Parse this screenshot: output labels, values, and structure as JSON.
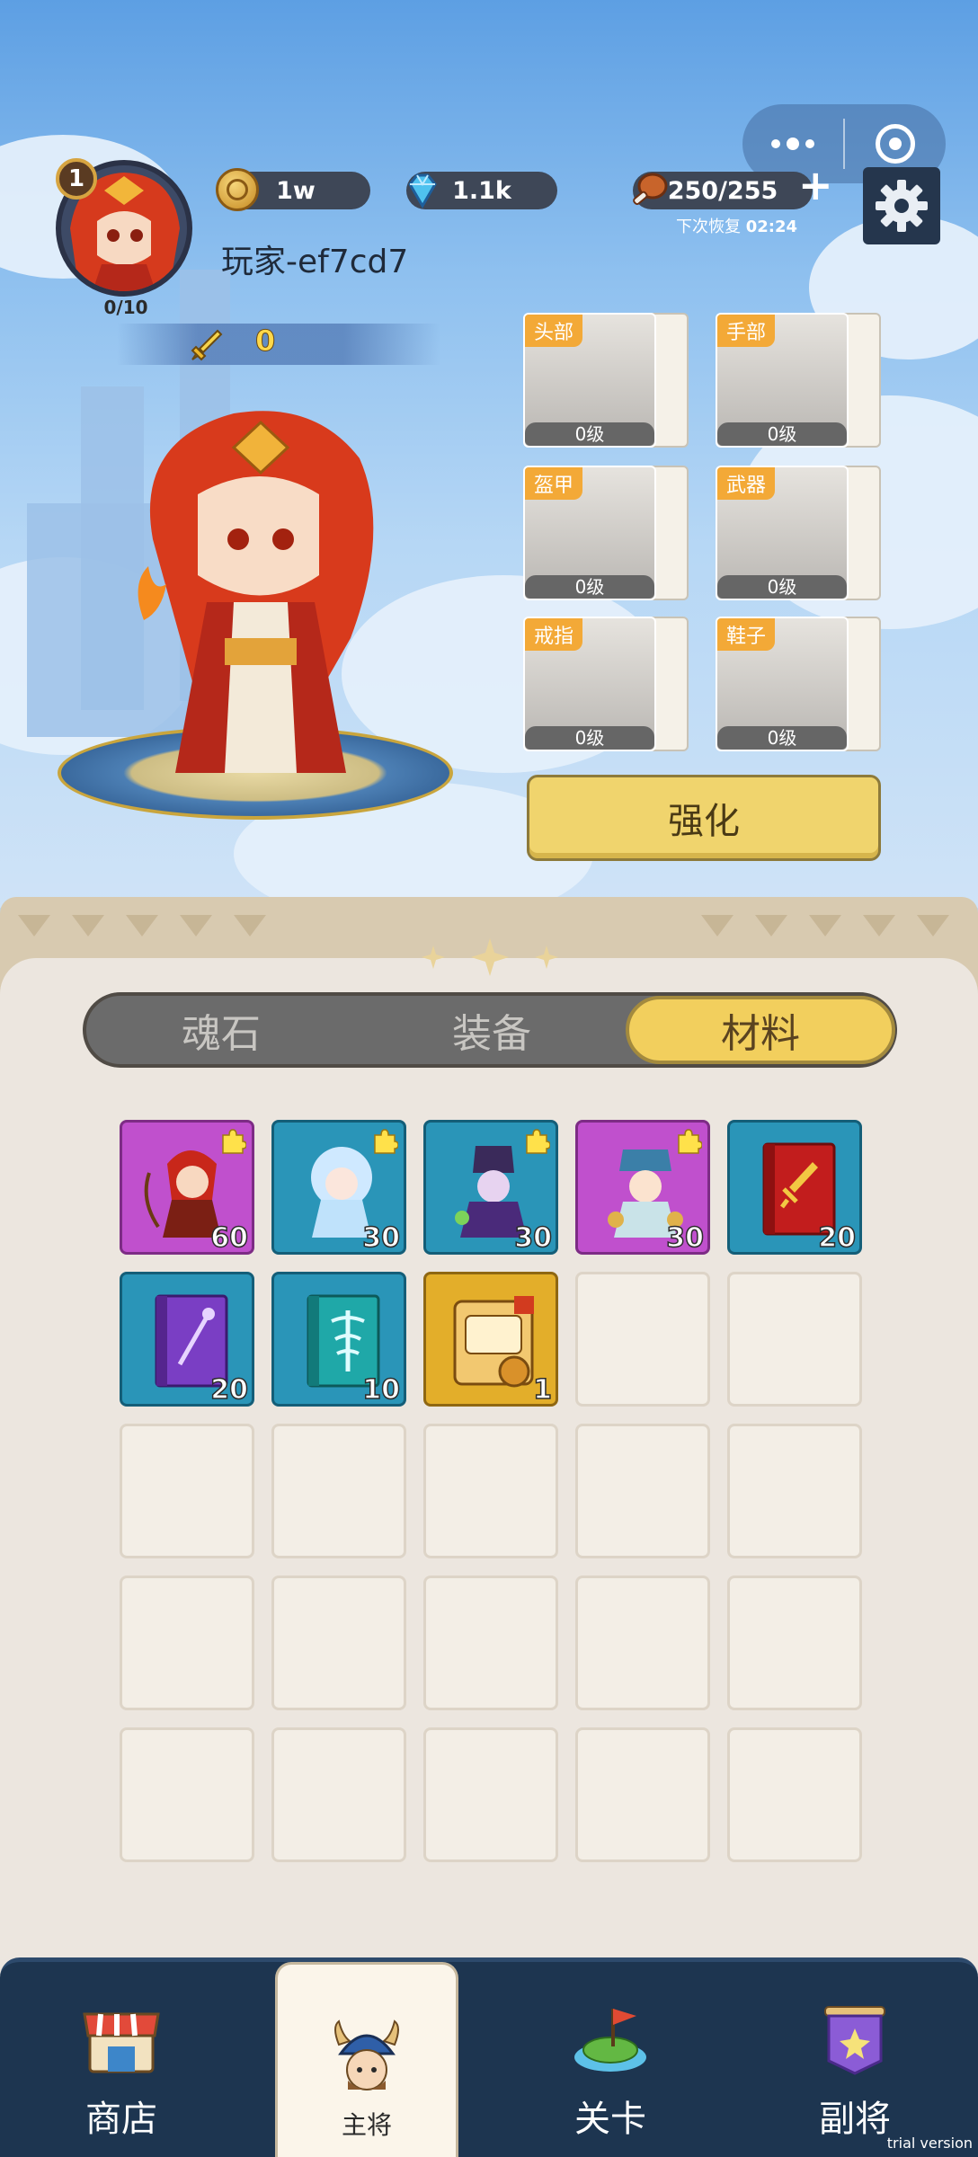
{
  "capsule": {
    "more": "more-icon",
    "close": "target-icon"
  },
  "player": {
    "level": "1",
    "exp": "0/10",
    "name": "玩家-ef7cd7",
    "power": "0"
  },
  "resources": {
    "gold": "1w",
    "diamond": "1.1k",
    "stamina": "250/255",
    "recover_label": "下次恢复",
    "recover_time": "02:24"
  },
  "equipment": [
    {
      "slot": "头部",
      "level": "0级"
    },
    {
      "slot": "手部",
      "level": "0级"
    },
    {
      "slot": "盔甲",
      "level": "0级"
    },
    {
      "slot": "武器",
      "level": "0级"
    },
    {
      "slot": "戒指",
      "level": "0级"
    },
    {
      "slot": "鞋子",
      "level": "0级"
    }
  ],
  "enhance_label": "强化",
  "tabs": [
    {
      "label": "魂石",
      "active": false
    },
    {
      "label": "装备",
      "active": false
    },
    {
      "label": "材料",
      "active": true
    }
  ],
  "inventory": [
    {
      "item": "archer-hero-shard",
      "count": "60",
      "color": "purple"
    },
    {
      "item": "ice-fairy-shard",
      "count": "30",
      "color": "blue"
    },
    {
      "item": "dark-mage-shard",
      "count": "30",
      "color": "blue"
    },
    {
      "item": "elder-sage-shard",
      "count": "30",
      "color": "purple"
    },
    {
      "item": "red-sword-book",
      "count": "20",
      "color": "blue"
    },
    {
      "item": "purple-staff-book",
      "count": "20",
      "color": "blue"
    },
    {
      "item": "teal-caduceus-book",
      "count": "10",
      "color": "blue"
    },
    {
      "item": "1-day-ad-free-card",
      "count": "1",
      "color": "gold"
    }
  ],
  "nav": [
    {
      "label": "商店",
      "active": false
    },
    {
      "label": "主将",
      "active": true
    },
    {
      "label": "关卡",
      "active": false
    },
    {
      "label": "副将",
      "active": false
    }
  ],
  "trial_label": "trial version"
}
